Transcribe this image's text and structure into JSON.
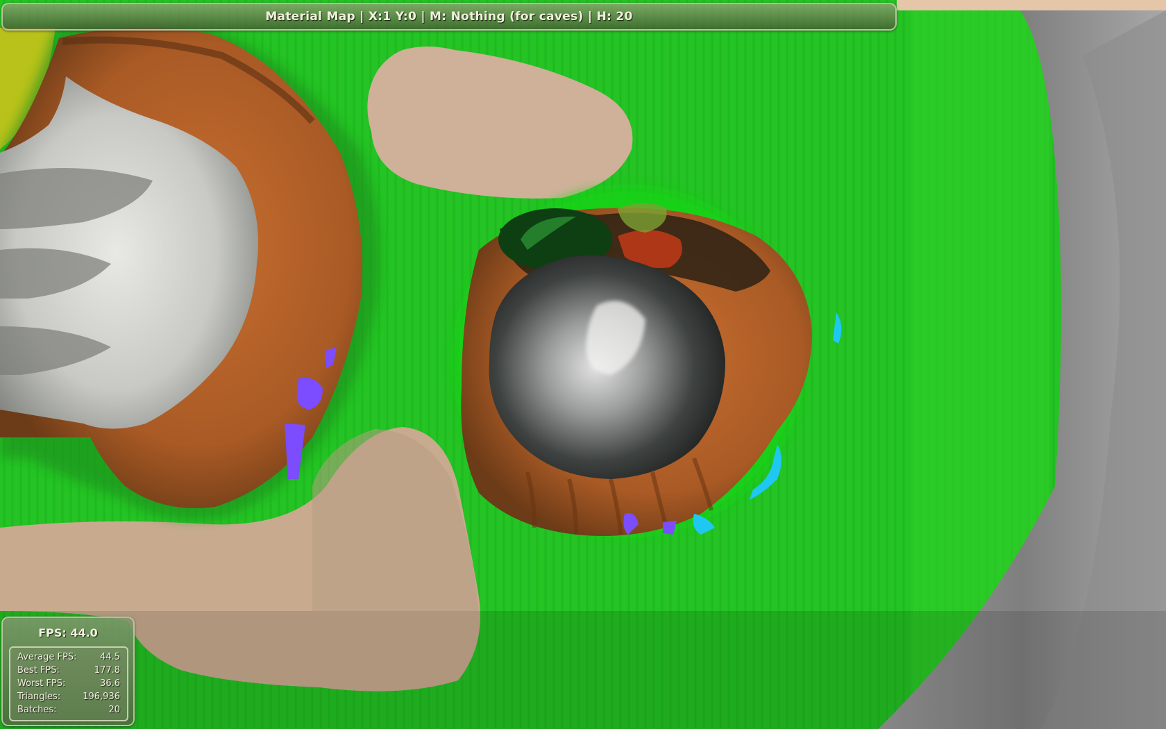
{
  "title_bar": {
    "text": "Material Map | X:1 Y:0 | M: Nothing (for caves) | H: 20"
  },
  "fps_panel": {
    "title": "FPS: 44.0",
    "stats": [
      {
        "label": "Average FPS:",
        "value": "44.5"
      },
      {
        "label": "Best FPS:",
        "value": "177.8"
      },
      {
        "label": "Worst FPS:",
        "value": "36.6"
      },
      {
        "label": "Triangles:",
        "value": "196,936"
      },
      {
        "label": "Batches:",
        "value": "20"
      }
    ]
  },
  "colors": {
    "grass": "#23c423",
    "sand": "#cdae95",
    "rock_brown": "#b5622a",
    "snow": "#d9dad6",
    "boulder_dark": "#2b2e2c",
    "water_purple": "#7a50ff",
    "water_cyan": "#24c8f0",
    "panel_green": "#5a7a45"
  }
}
